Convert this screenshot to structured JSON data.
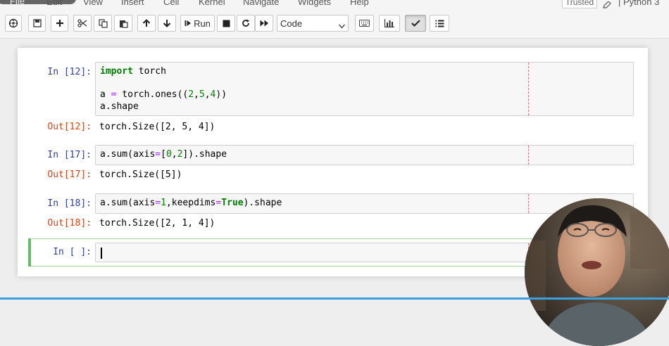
{
  "menubar": {
    "items": [
      "File",
      "Edit",
      "View",
      "Insert",
      "Cell",
      "Kernel",
      "Navigate",
      "Widgets",
      "Help"
    ],
    "trusted": "Trusted",
    "kernel": "Python 3"
  },
  "toolbar": {
    "run_label": "Run",
    "cell_type": "Code",
    "icons": [
      "save-icon",
      "plus-icon",
      "scissors-icon",
      "copy-icon",
      "paste-icon",
      "arrow-up-icon",
      "arrow-down-icon",
      "step-forward-icon",
      "stop-icon",
      "refresh-icon",
      "fast-forward-icon",
      "keyboard-icon",
      "bar-chart-icon",
      "check-icon",
      "list-icon"
    ]
  },
  "cells": [
    {
      "in_prompt": "In [12]:",
      "lines": [
        {
          "kw": "import",
          "rest": " torch"
        },
        {
          "text": ""
        },
        {
          "a": "a ",
          "op": "=",
          "b": " torch.ones((",
          "n1": "2",
          "c1": ",",
          "n2": "5",
          "c2": ",",
          "n3": "4",
          "end": "))"
        },
        {
          "text": "a.shape"
        }
      ],
      "out_prompt": "Out[12]:",
      "output": "torch.Size([2, 5, 4])"
    },
    {
      "in_prompt": "In [17]:",
      "code_parts": {
        "a": "a.sum(axis",
        "op": "=",
        "b": "[",
        "n1": "0",
        "c": ",",
        "n2": "2",
        "d": "]",
        "e": ").shape"
      },
      "out_prompt": "Out[17]:",
      "output": "torch.Size([5])"
    },
    {
      "in_prompt": "In [18]:",
      "code_parts": {
        "a": "a.sum(axis",
        "op1": "=",
        "n1": "1",
        "b": ",keepdims",
        "op2": "=",
        "kw": "True",
        "c": ").shape"
      },
      "out_prompt": "Out[18]:",
      "output": "torch.Size([2, 1, 4])"
    },
    {
      "in_prompt": "In [ ]:"
    }
  ],
  "colors": {
    "in_prompt": "#303f9f",
    "out_prompt": "#d84315",
    "keyword": "#008000",
    "selected_cell": "#66bb6a"
  }
}
